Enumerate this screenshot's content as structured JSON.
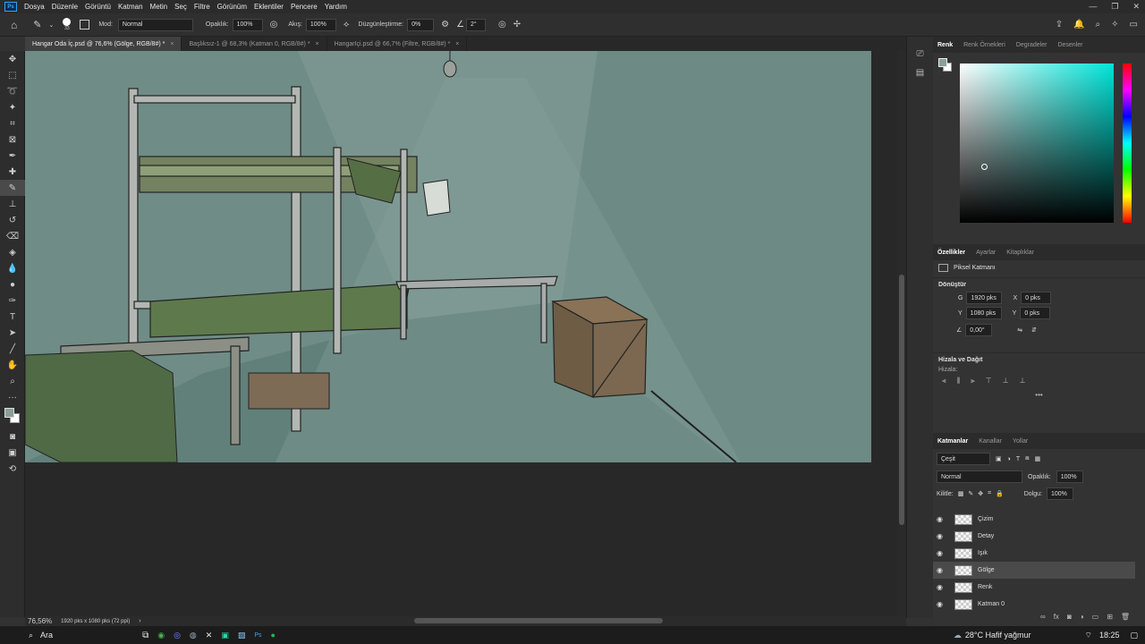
{
  "menu": {
    "logo": "Ps",
    "items": [
      "Dosya",
      "Düzenle",
      "Görüntü",
      "Katman",
      "Metin",
      "Seç",
      "Filtre",
      "Görünüm",
      "Eklentiler",
      "Pencere",
      "Yardım"
    ]
  },
  "options": {
    "brush_size": "33",
    "mode_label": "Mod:",
    "mode_value": "Normal",
    "opacity_label": "Opaklık:",
    "opacity_value": "100%",
    "flow_label": "Akış:",
    "flow_value": "100%",
    "smoothing_label": "Düzgünleştirme:",
    "smoothing_value": "0%",
    "angle_value": "2°"
  },
  "tabs": [
    {
      "label": "Hangar Oda İç.psd @ 76,6% (Gölge, RGB/8#) *"
    },
    {
      "label": "Başlıksız-1 @ 68,3% (Katman 0, RGB/8#) *"
    },
    {
      "label": "HangarIçi.psd @ 66,7% (Filtre, RGB/8#) *"
    }
  ],
  "status": {
    "zoom": "76,56%",
    "dims": "1920 pks x 1080 pks (72 ppi)"
  },
  "color_panel": {
    "tabs": [
      "Renk",
      "Renk Örnekleri",
      "Degradeler",
      "Desenler"
    ]
  },
  "properties": {
    "tabs": [
      "Özellikler",
      "Ayarlar",
      "Kitaplıklar"
    ],
    "kind": "Piksel Katmanı",
    "transform_title": "Dönüştür",
    "w_label": "G",
    "w_value": "1920 pks",
    "x_label": "X",
    "x_value": "0 pks",
    "h_label": "Y",
    "h_value": "1080 pks",
    "y_label": "Y",
    "y_value": "0 pks",
    "angle": "0,00°",
    "align_title": "Hizala ve Dağıt",
    "align_label": "Hizala:",
    "more": "•••"
  },
  "layers_panel": {
    "tabs": [
      "Katmanlar",
      "Kanallar",
      "Yollar"
    ],
    "filter": "Çeşit",
    "blend": "Normal",
    "opacity_label": "Opaklık:",
    "opacity_value": "100%",
    "lock_label": "Kilitle:",
    "fill_label": "Dolgu:",
    "fill_value": "100%",
    "layers": [
      {
        "name": "Çizim",
        "selected": false
      },
      {
        "name": "Detay",
        "selected": false
      },
      {
        "name": "Işık",
        "selected": false
      },
      {
        "name": "Gölge",
        "selected": true
      },
      {
        "name": "Renk",
        "selected": false
      },
      {
        "name": "Katman 0",
        "selected": false
      }
    ]
  },
  "taskbar": {
    "search": "Ara",
    "weather": "28°C Hafif yağmur",
    "time": "18:25"
  },
  "colors": {
    "accent": "#31a8ff",
    "wall": "#6c8a84",
    "floor": "#5f7d77"
  }
}
